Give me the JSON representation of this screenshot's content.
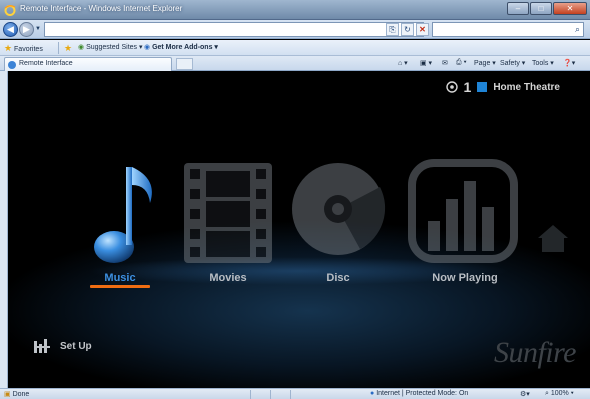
{
  "window": {
    "title": "Remote Interface - Windows Internet Explorer",
    "caption_buttons": {
      "minimize": "–",
      "maximize": "□",
      "close": "✕"
    }
  },
  "toolbar": {
    "address_tools": {
      "compat": "⎘",
      "refresh": "↻",
      "stop": "✕"
    },
    "search_icon": "⌕"
  },
  "favorites_bar": {
    "favorites": "Favorites",
    "suggested_sites": "Suggested Sites ▾",
    "get_more_addons": "Get More Add-ons ▾"
  },
  "tab": {
    "label": "Remote Interface"
  },
  "command_bar": {
    "home": "⌂ ▾",
    "feeds": "▣ ▾",
    "mail": "✉",
    "print": "▾",
    "page": "Page ▾",
    "safety": "Safety ▾",
    "tools": "Tools ▾",
    "help": "❓▾"
  },
  "app": {
    "zone_number": "1",
    "zone_name": "Home Theatre",
    "zone_color": "#1f84d6",
    "tiles": [
      {
        "id": "music",
        "label": "Music",
        "icon": "music-note-icon",
        "active": true
      },
      {
        "id": "movies",
        "label": "Movies",
        "icon": "film-strip-icon",
        "active": false
      },
      {
        "id": "disc",
        "label": "Disc",
        "icon": "disc-icon",
        "active": false
      },
      {
        "id": "now-playing",
        "label": "Now Playing",
        "icon": "equalizer-bars-icon",
        "active": false
      }
    ],
    "setup_label": "Set Up",
    "brand": "Sunfire",
    "accent_color": "#f06d12"
  },
  "statusbar": {
    "status": "Done",
    "zone": "Internet | Protected Mode: On",
    "zoom": "100%"
  }
}
